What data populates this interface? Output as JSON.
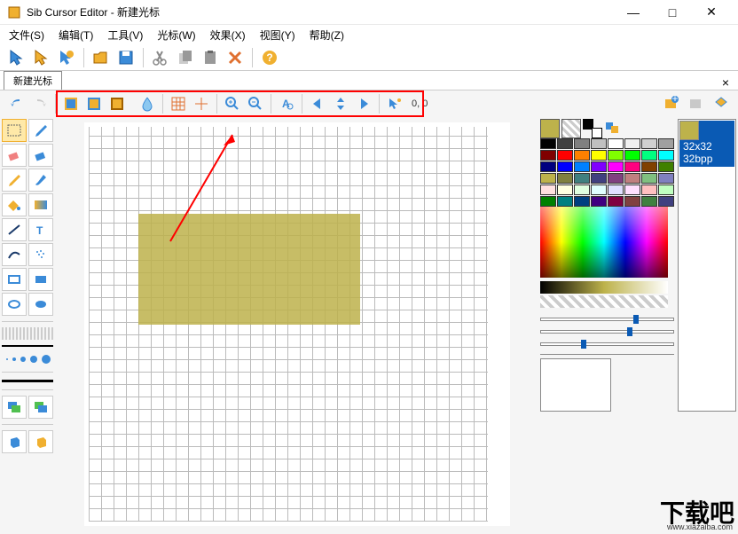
{
  "window": {
    "title": "Sib Cursor Editor - 新建光标",
    "min": "—",
    "max": "□",
    "close": "✕"
  },
  "menu": {
    "file": "文件(S)",
    "edit": "编辑(T)",
    "tools": "工具(V)",
    "cursor": "光标(W)",
    "effects": "效果(X)",
    "view": "视图(Y)",
    "help": "帮助(Z)"
  },
  "tabs": {
    "tab1": "新建光标",
    "close": "×"
  },
  "toolbar2": {
    "coord": "0, 0"
  },
  "format": {
    "size": "32x32",
    "bpp": "32bpp"
  },
  "palette_colors": [
    "#000000",
    "#404040",
    "#808080",
    "#c0c0c0",
    "#ffffff",
    "#f0f0f0",
    "#d0d0d0",
    "#a0a0a0",
    "#800000",
    "#ff0000",
    "#ff8000",
    "#ffff00",
    "#80ff00",
    "#00ff00",
    "#00ff80",
    "#00ffff",
    "#000080",
    "#0000ff",
    "#0080ff",
    "#8000ff",
    "#ff00ff",
    "#ff0080",
    "#804000",
    "#408000",
    "#bdb24b",
    "#808040",
    "#408080",
    "#404080",
    "#804080",
    "#c08080",
    "#80c080",
    "#8080c0",
    "#ffe0e0",
    "#ffffe0",
    "#e0ffe0",
    "#e0ffff",
    "#e0e0ff",
    "#ffe0ff",
    "#ffc0c0",
    "#c0ffc0",
    "#008000",
    "#008080",
    "#004080",
    "#400080",
    "#800040",
    "#804040",
    "#408040",
    "#404080"
  ],
  "watermark": {
    "logo": "下载吧",
    "url": "www.xiazaiba.com"
  }
}
